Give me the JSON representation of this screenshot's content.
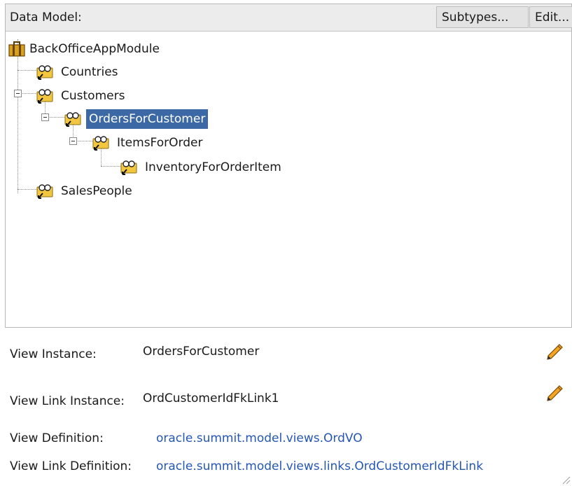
{
  "panel": {
    "title": "Data Model:",
    "subtypes_button": "Subtypes...",
    "edit_button": "Edit..."
  },
  "tree": {
    "root": "BackOfficeAppModule",
    "countries": "Countries",
    "customers": "Customers",
    "orders_for_customer": "OrdersForCustomer",
    "items_for_order": "ItemsForOrder",
    "inventory_for_order_item": "InventoryForOrderItem",
    "sales_people": "SalesPeople",
    "selected": "OrdersForCustomer"
  },
  "properties": {
    "view_instance_label": "View Instance:",
    "view_instance_value": "OrdersForCustomer",
    "view_link_instance_label": "View Link Instance:",
    "view_link_instance_value": "OrdCustomerIdFkLink1",
    "view_definition_label": "View Definition:",
    "view_definition_value": "oracle.summit.model.views.OrdVO",
    "view_link_definition_label": "View Link Definition:",
    "view_link_definition_value": "oracle.summit.model.views.links.OrdCustomerIdFkLink"
  },
  "icons": {
    "app_module": "briefcase-icon",
    "view_object": "view-object-icon",
    "edit": "pencil-icon"
  },
  "colors": {
    "selection": "#3c69a6",
    "link": "#2456b4"
  }
}
